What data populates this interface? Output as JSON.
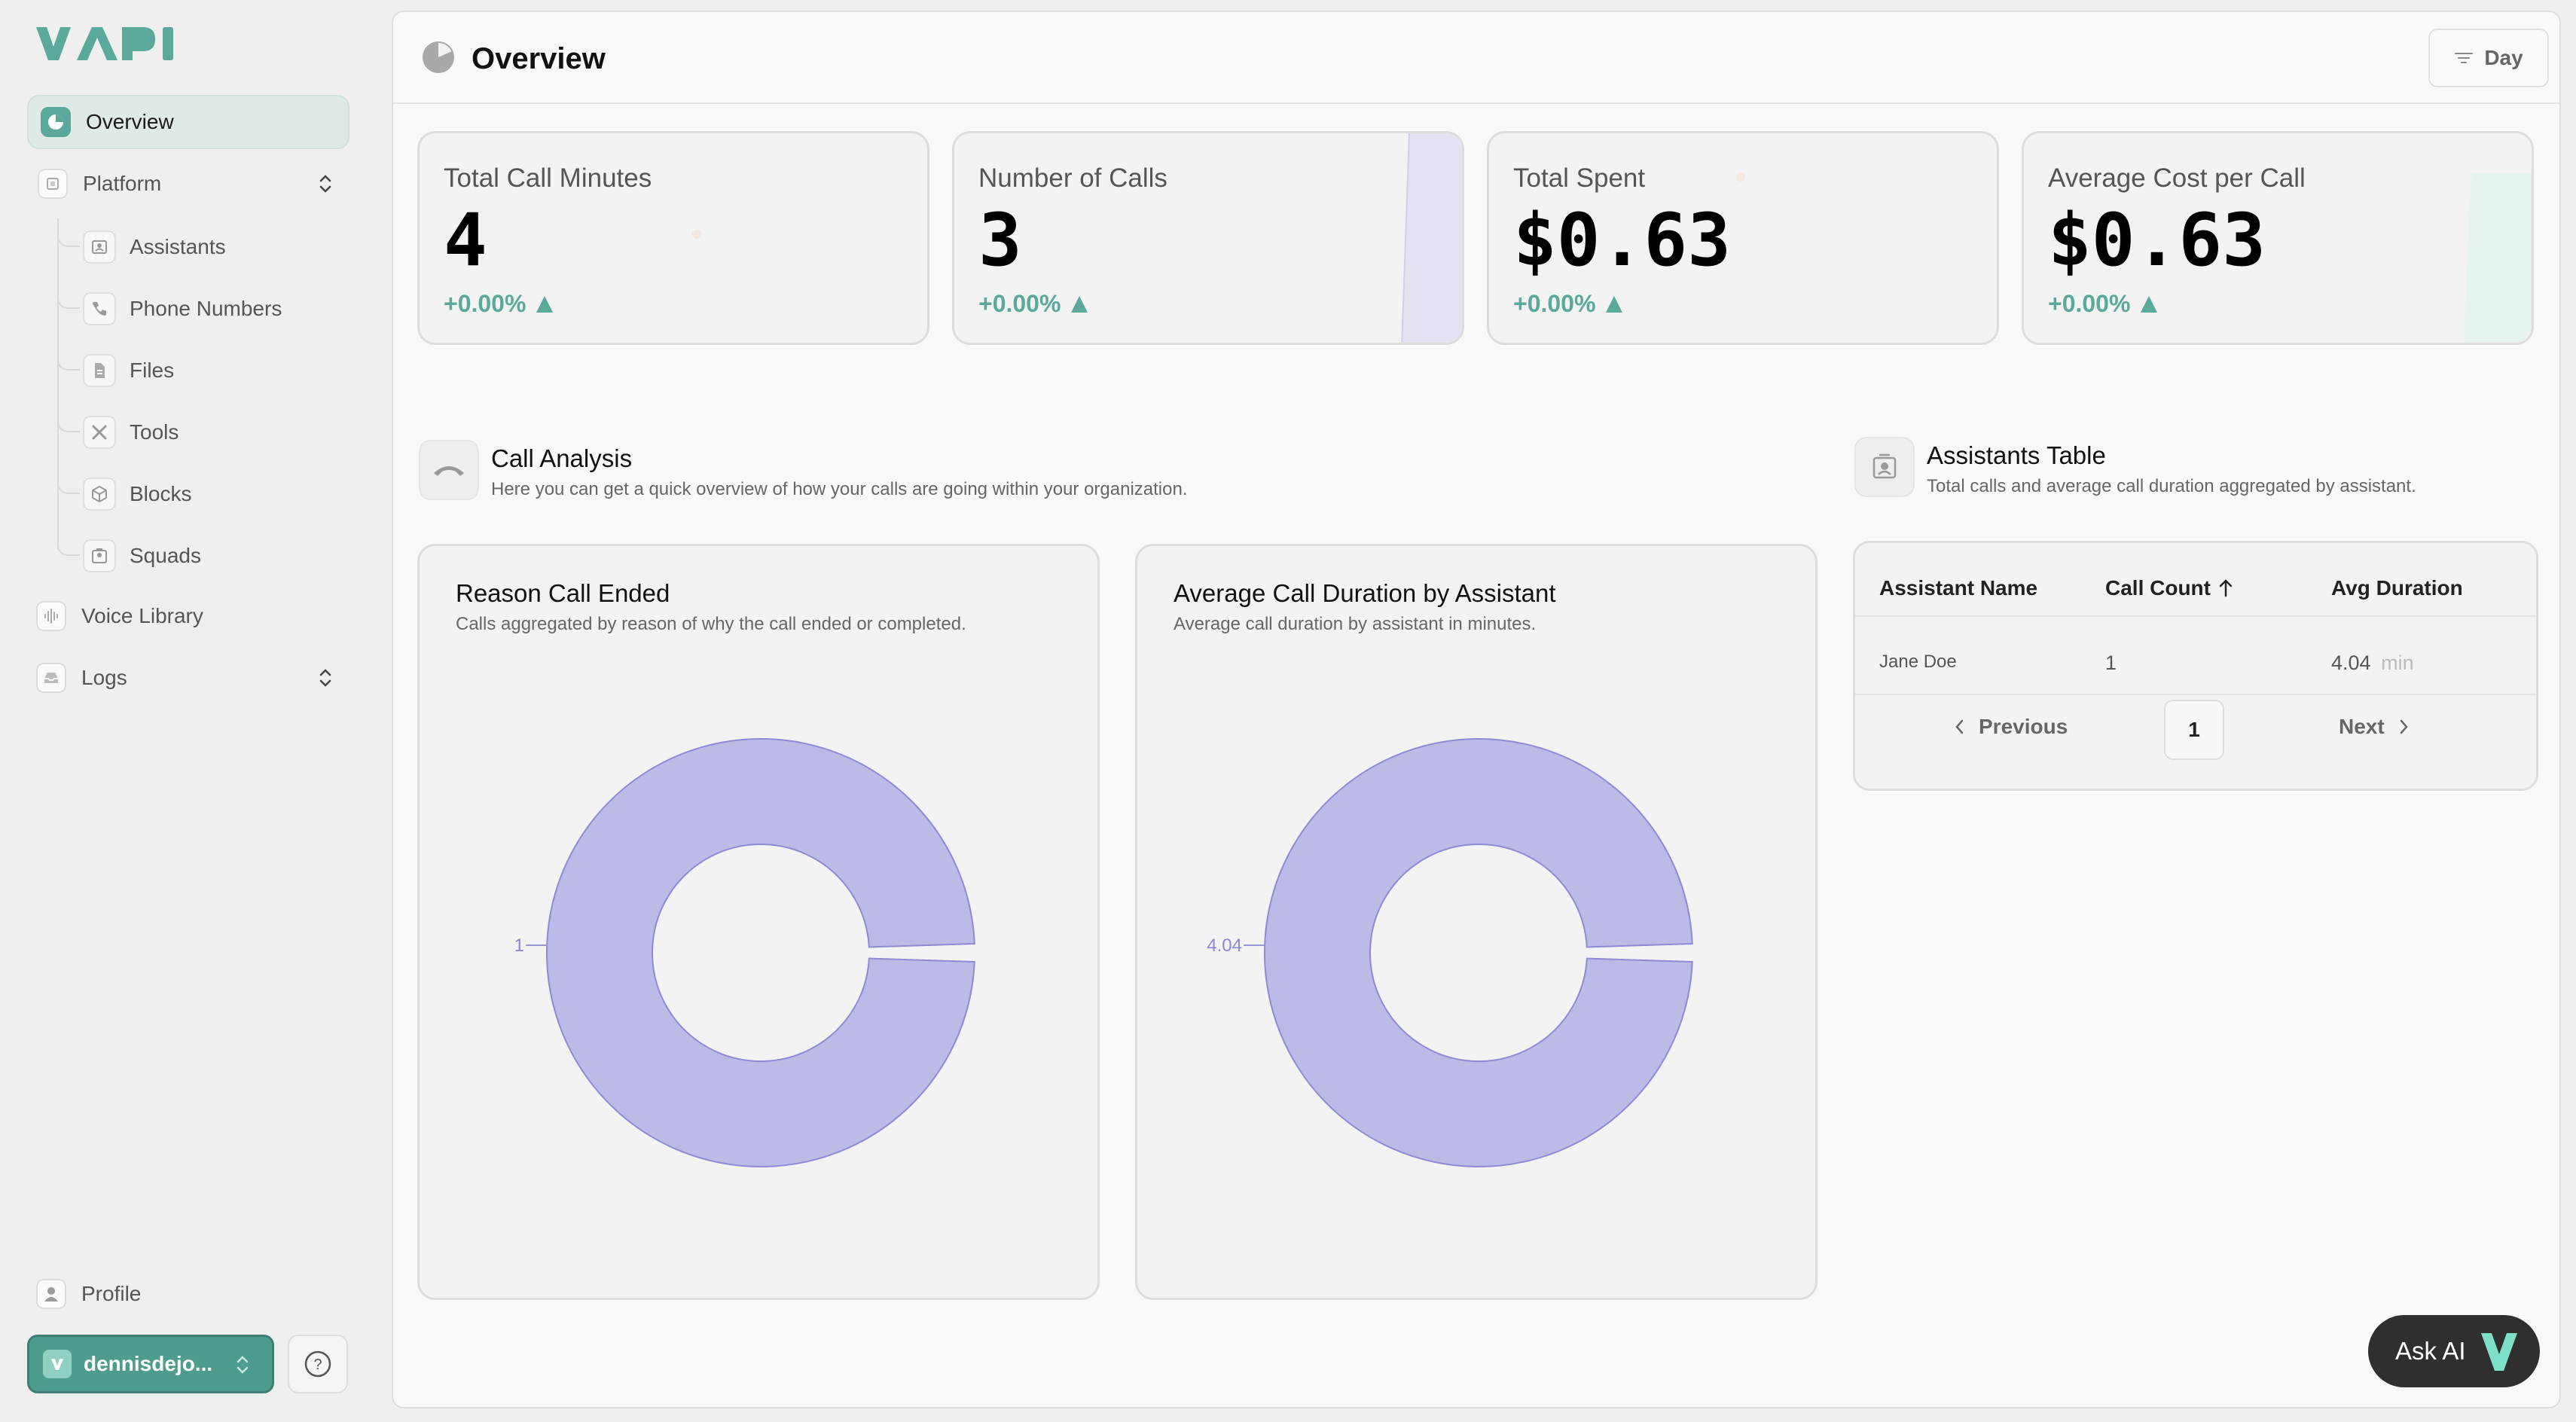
{
  "sidebar": {
    "logo": "VAPI",
    "overview": "Overview",
    "platform": "Platform",
    "platform_items": [
      "Assistants",
      "Phone Numbers",
      "Files",
      "Tools",
      "Blocks",
      "Squads"
    ],
    "voice_library": "Voice Library",
    "logs": "Logs",
    "profile": "Profile",
    "org_name": "dennisdejo..."
  },
  "header": {
    "title": "Overview",
    "range_button": "Day"
  },
  "stats": [
    {
      "label": "Total Call Minutes",
      "value": "4",
      "change": "+0.00%"
    },
    {
      "label": "Number of Calls",
      "value": "3",
      "change": "+0.00%"
    },
    {
      "label": "Total Spent",
      "value": "$0.63",
      "change": "+0.00%"
    },
    {
      "label": "Average Cost per Call",
      "value": "$0.63",
      "change": "+0.00%"
    }
  ],
  "call_analysis": {
    "title": "Call Analysis",
    "subtitle": "Here you can get a quick overview of how your calls are going within your organization."
  },
  "assistants_table": {
    "title": "Assistants Table",
    "subtitle": "Total calls and average call duration aggregated by assistant.",
    "columns": [
      "Assistant Name",
      "Call Count",
      "Avg Duration"
    ],
    "rows": [
      {
        "name": "Jane Doe",
        "count": "1",
        "duration": "4.04",
        "unit": "min"
      }
    ],
    "previous": "Previous",
    "next": "Next",
    "page": "1"
  },
  "charts": {
    "reason": {
      "title": "Reason Call Ended",
      "subtitle": "Calls aggregated by reason of why the call ended or completed."
    },
    "duration": {
      "title": "Average Call Duration by Assistant",
      "subtitle": "Average call duration by assistant in minutes."
    }
  },
  "chart_data": [
    {
      "type": "pie",
      "title": "Reason Call Ended",
      "labels": [
        "1"
      ],
      "values": [
        1
      ],
      "colors": [
        "#bcbae6"
      ]
    },
    {
      "type": "pie",
      "title": "Average Call Duration by Assistant",
      "labels": [
        "4.04"
      ],
      "values": [
        4.04
      ],
      "colors": [
        "#bcbae6"
      ]
    }
  ],
  "ask_ai": "Ask AI",
  "colors": {
    "accent": "#5aa99b",
    "donut_fill": "#bcbae6",
    "donut_stroke": "#8f89d6"
  }
}
